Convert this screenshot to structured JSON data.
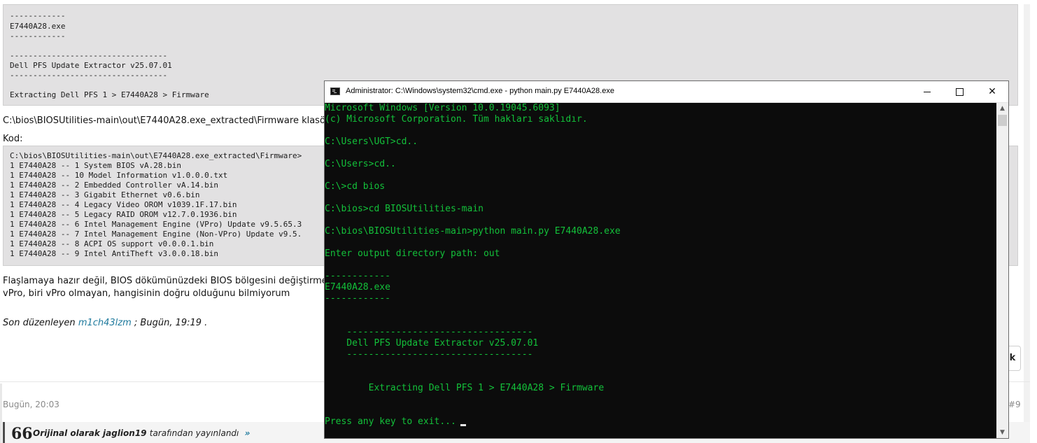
{
  "forum": {
    "top_code_lines": [
      "------------",
      "E7440A28.exe",
      "------------",
      "",
      "----------------------------------",
      "Dell PFS Update Extractor v25.07.01",
      "----------------------------------",
      "",
      "Extracting Dell PFS 1 > E7440A28 > Firmware"
    ],
    "path_text": "C:\\bios\\BIOSUtilities-main\\out\\E7440A28.exe_extracted\\Firmware klasör",
    "kod_label": "Kod:",
    "code_lines": [
      "C:\\bios\\BIOSUtilities-main\\out\\E7440A28.exe_extracted\\Firmware>",
      "1 E7440A28 -- 1 System BIOS vA.28.bin",
      "1 E7440A28 -- 10 Model Information v1.0.0.0.txt",
      "1 E7440A28 -- 2 Embedded Controller vA.14.bin",
      "1 E7440A28 -- 3 Gigabit Ethernet v0.6.bin",
      "1 E7440A28 -- 4 Legacy Video OROM v1039.1F.17.bin",
      "1 E7440A28 -- 5 Legacy RAID OROM v12.7.0.1936.bin",
      "1 E7440A28 -- 6 Intel Management Engine (VPro) Update v9.5.65.3",
      "1 E7440A28 -- 7 Intel Management Engine (Non-VPro) Update v9.5.",
      "1 E7440A28 -- 8 ACPI OS support v0.0.0.1.bin",
      "1 E7440A28 -- 9 Intel AntiTheft v3.0.0.18.bin"
    ],
    "paragraph_line1": "Flaşlamaya hazır değil, BIOS dökümünüzdeki BIOS bölgesini değiştirmek için",
    "paragraph_line2": "vPro, biri vPro olmayan, hangisinin doğru olduğunu bilmiyorum",
    "edited_prefix": "Son düzenleyen",
    "edited_user": "m1ch43lzm",
    "edited_suffix": "; Bugün, 19:19 .",
    "button_edge_text": "k",
    "post_date": "Bugün, 20:03",
    "post_number": "#9",
    "quote_mark": "66",
    "quote_author": "Orijinal olarak jaglion19",
    "quote_suffix": "tarafından yayınlandı",
    "quote_arrow": "»"
  },
  "cmd": {
    "title": "Administrator: C:\\Windows\\system32\\cmd.exe - python  main.py E7440A28.exe",
    "minimize_label": "",
    "maximize_label": "",
    "close_label": "✕",
    "lines": [
      "Microsoft Windows [Version 10.0.19045.6093]",
      "(c) Microsoft Corporation. Tüm hakları saklıdır.",
      "",
      "C:\\Users\\UGT>cd..",
      "",
      "C:\\Users>cd..",
      "",
      "C:\\>cd bios",
      "",
      "C:\\bios>cd BIOSUtilities-main",
      "",
      "C:\\bios\\BIOSUtilities-main>python main.py E7440A28.exe",
      "",
      "Enter output directory path: out",
      "",
      "------------",
      "E7440A28.exe",
      "------------",
      "",
      "",
      "    ----------------------------------",
      "    Dell PFS Update Extractor v25.07.01",
      "    ----------------------------------",
      "",
      "",
      "        Extracting Dell PFS 1 > E7440A28 > Firmware",
      "",
      "",
      "Press any key to exit..."
    ],
    "colors": {
      "text": "#13c13a",
      "background": "#0c0c0c"
    }
  }
}
